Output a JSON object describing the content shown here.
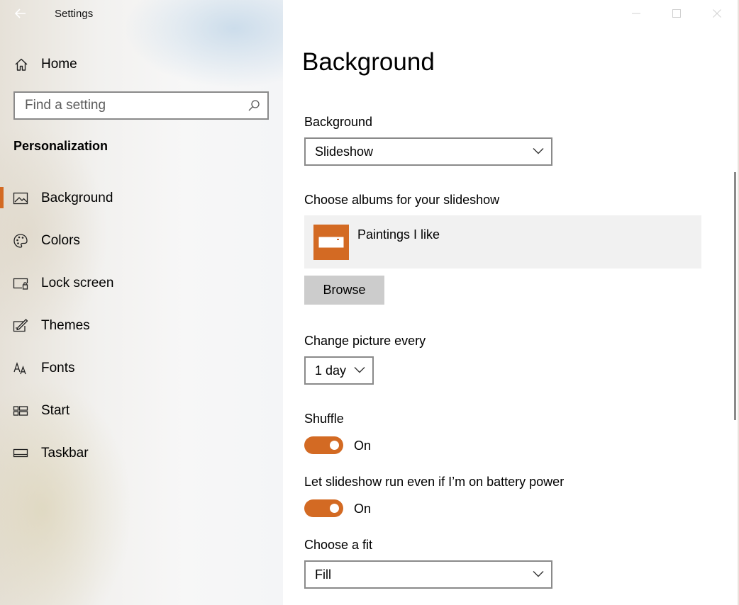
{
  "window": {
    "title": "Settings"
  },
  "sidebar": {
    "home_label": "Home",
    "search": {
      "placeholder": "Find a setting",
      "value": ""
    },
    "section_title": "Personalization",
    "items": [
      {
        "label": "Background",
        "icon": "picture-icon",
        "selected": true
      },
      {
        "label": "Colors",
        "icon": "palette-icon",
        "selected": false
      },
      {
        "label": "Lock screen",
        "icon": "lock-screen-icon",
        "selected": false
      },
      {
        "label": "Themes",
        "icon": "themes-icon",
        "selected": false
      },
      {
        "label": "Fonts",
        "icon": "fonts-icon",
        "selected": false
      },
      {
        "label": "Start",
        "icon": "start-icon",
        "selected": false
      },
      {
        "label": "Taskbar",
        "icon": "taskbar-icon",
        "selected": false
      }
    ]
  },
  "main": {
    "page_title": "Background",
    "background": {
      "label": "Background",
      "value": "Slideshow"
    },
    "albums": {
      "label": "Choose albums for your slideshow",
      "album_name": "Paintings I like",
      "browse_label": "Browse"
    },
    "change_picture": {
      "label": "Change picture every",
      "value": "1 day"
    },
    "shuffle": {
      "label": "Shuffle",
      "state": "On",
      "on": true
    },
    "battery": {
      "label": "Let slideshow run even if I’m on battery power",
      "state": "On",
      "on": true
    },
    "fit": {
      "label": "Choose a fit",
      "value": "Fill"
    }
  },
  "colors": {
    "accent": "#d36a23",
    "control_border": "#8a8a8a",
    "button_bg": "#cccccc",
    "card_bg": "#f1f1f1"
  }
}
